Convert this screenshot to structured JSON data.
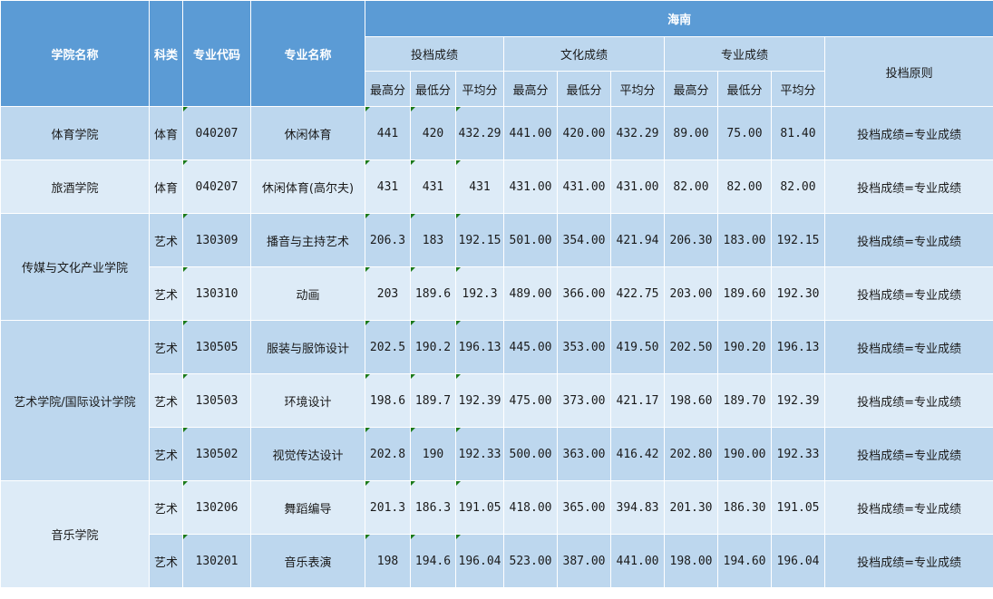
{
  "header": {
    "college": "学院名称",
    "category": "科类",
    "code": "专业代码",
    "major": "专业名称",
    "region": "海南",
    "groups": [
      "投档成绩",
      "文化成绩",
      "专业成绩"
    ],
    "rule": "投档原则",
    "subcols": [
      "最高分",
      "最低分",
      "平均分"
    ]
  },
  "colleges": [
    {
      "name": "体育学院",
      "shade": "a",
      "rows": [
        {
          "cat": "体育",
          "code": "040207",
          "major": "休闲体育",
          "tou": [
            "441",
            "420",
            "432.29"
          ],
          "wen": [
            "441.00",
            "420.00",
            "432.29"
          ],
          "zhuan": [
            "89.00",
            "75.00",
            "81.40"
          ],
          "rule": "投档成绩=专业成绩"
        }
      ]
    },
    {
      "name": "旅酒学院",
      "shade": "b",
      "rows": [
        {
          "cat": "体育",
          "code": "040207",
          "major": "休闲体育(高尔夫)",
          "tou": [
            "431",
            "431",
            "431"
          ],
          "wen": [
            "431.00",
            "431.00",
            "431.00"
          ],
          "zhuan": [
            "82.00",
            "82.00",
            "82.00"
          ],
          "rule": "投档成绩=专业成绩"
        }
      ]
    },
    {
      "name": "传媒与文化产业学院",
      "shade": "a",
      "rows": [
        {
          "cat": "艺术",
          "code": "130309",
          "major": "播音与主持艺术",
          "tou": [
            "206.3",
            "183",
            "192.15"
          ],
          "wen": [
            "501.00",
            "354.00",
            "421.94"
          ],
          "zhuan": [
            "206.30",
            "183.00",
            "192.15"
          ],
          "rule": "投档成绩=专业成绩"
        },
        {
          "cat": "艺术",
          "code": "130310",
          "major": "动画",
          "tou": [
            "203",
            "189.6",
            "192.3"
          ],
          "wen": [
            "489.00",
            "366.00",
            "422.75"
          ],
          "zhuan": [
            "203.00",
            "189.60",
            "192.30"
          ],
          "rule": "投档成绩=专业成绩"
        }
      ]
    },
    {
      "name": "艺术学院/国际设计学院",
      "shade": "a",
      "rows": [
        {
          "cat": "艺术",
          "code": "130505",
          "major": "服装与服饰设计",
          "tou": [
            "202.5",
            "190.2",
            "196.13"
          ],
          "wen": [
            "445.00",
            "353.00",
            "419.50"
          ],
          "zhuan": [
            "202.50",
            "190.20",
            "196.13"
          ],
          "rule": "投档成绩=专业成绩"
        },
        {
          "cat": "艺术",
          "code": "130503",
          "major": "环境设计",
          "tou": [
            "198.6",
            "189.7",
            "192.39"
          ],
          "wen": [
            "475.00",
            "373.00",
            "421.17"
          ],
          "zhuan": [
            "198.60",
            "189.70",
            "192.39"
          ],
          "rule": "投档成绩=专业成绩"
        },
        {
          "cat": "艺术",
          "code": "130502",
          "major": "视觉传达设计",
          "tou": [
            "202.8",
            "190",
            "192.33"
          ],
          "wen": [
            "500.00",
            "363.00",
            "416.42"
          ],
          "zhuan": [
            "202.80",
            "190.00",
            "192.33"
          ],
          "rule": "投档成绩=专业成绩"
        }
      ]
    },
    {
      "name": "音乐学院",
      "shade": "b",
      "rows": [
        {
          "cat": "艺术",
          "code": "130206",
          "major": "舞蹈编导",
          "tou": [
            "201.3",
            "186.3",
            "191.05"
          ],
          "wen": [
            "418.00",
            "365.00",
            "394.83"
          ],
          "zhuan": [
            "201.30",
            "186.30",
            "191.05"
          ],
          "rule": "投档成绩=专业成绩"
        },
        {
          "cat": "艺术",
          "code": "130201",
          "major": "音乐表演",
          "tou": [
            "198",
            "194.6",
            "196.04"
          ],
          "wen": [
            "523.00",
            "387.00",
            "441.00"
          ],
          "zhuan": [
            "198.00",
            "194.60",
            "196.04"
          ],
          "rule": "投档成绩=专业成绩"
        }
      ]
    }
  ]
}
